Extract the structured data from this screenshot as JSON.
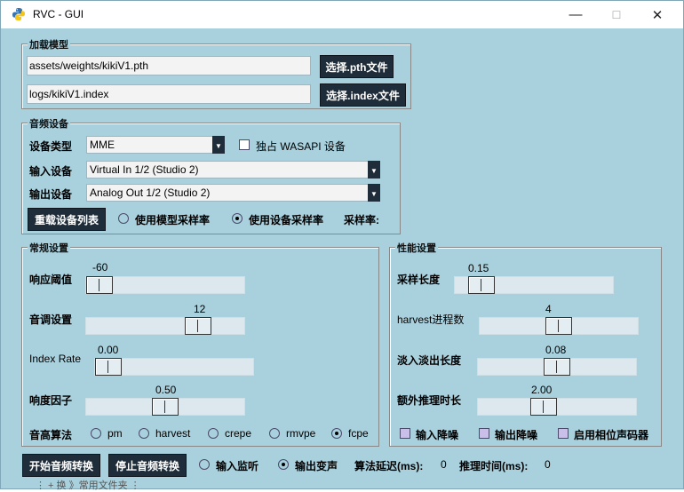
{
  "window": {
    "title": "RVC - GUI",
    "minimize_glyph": "—",
    "maximize_glyph": "☐",
    "close_glyph": "✕"
  },
  "load_model": {
    "legend": "加载模型",
    "pth_path": "assets/weights/kikiV1.pth",
    "pth_button": "选择.pth文件",
    "index_path": "logs/kikiV1.index",
    "index_button": "选择.index文件"
  },
  "audio": {
    "legend": "音频设备",
    "device_type_label": "设备类型",
    "device_type_value": "MME",
    "wasapi_label": "独占 WASAPI 设备",
    "input_label": "输入设备",
    "input_value": "Virtual In 1/2 (Studio 2)",
    "output_label": "输出设备",
    "output_value": "Analog Out 1/2 (Studio 2)",
    "reload_button": "重载设备列表",
    "radio_model_sr": "使用模型采样率",
    "radio_device_sr": "使用设备采样率",
    "sample_rate_label": "采样率:"
  },
  "general": {
    "legend": "常规设置",
    "threshold_label": "响应阈值",
    "threshold_value": "-60",
    "threshold_level": 0.0,
    "pitch_label": "音调设置",
    "pitch_value": "12",
    "pitch_level": 0.75,
    "index_rate_label": "Index Rate",
    "index_rate_value": "0.00",
    "index_rate_level": 0.0,
    "rms_label": "响度因子",
    "rms_value": "0.50",
    "rms_level": 0.5,
    "f0_label": "音高算法",
    "f0_options": [
      "pm",
      "harvest",
      "crepe",
      "rmvpe",
      "fcpe"
    ],
    "f0_selected": "fcpe"
  },
  "performance": {
    "legend": "性能设置",
    "block_label": "采样长度",
    "block_value": "0.15",
    "block_level": 0.1,
    "harvest_label": "harvest进程数",
    "harvest_value": "4",
    "harvest_level": 0.5,
    "crossfade_label": "淡入淡出长度",
    "crossfade_value": "0.08",
    "crossfade_level": 0.5,
    "extra_label": "额外推理时长",
    "extra_value": "2.00",
    "extra_level": 0.4,
    "input_denoise": "输入降噪",
    "output_denoise": "输出降噪",
    "phase_vocoder": "启用相位声码器"
  },
  "footer": {
    "start_button": "开始音频转换",
    "stop_button": "停止音频转换",
    "monitor_radio": "输入监听",
    "output_radio": "输出变声",
    "delay_label": "算法延迟(ms):",
    "delay_value": "0",
    "infer_label": "推理时间(ms):",
    "infer_value": "0"
  },
  "behind_text": "⋮ + 换 》常用文件夹 ⋮"
}
